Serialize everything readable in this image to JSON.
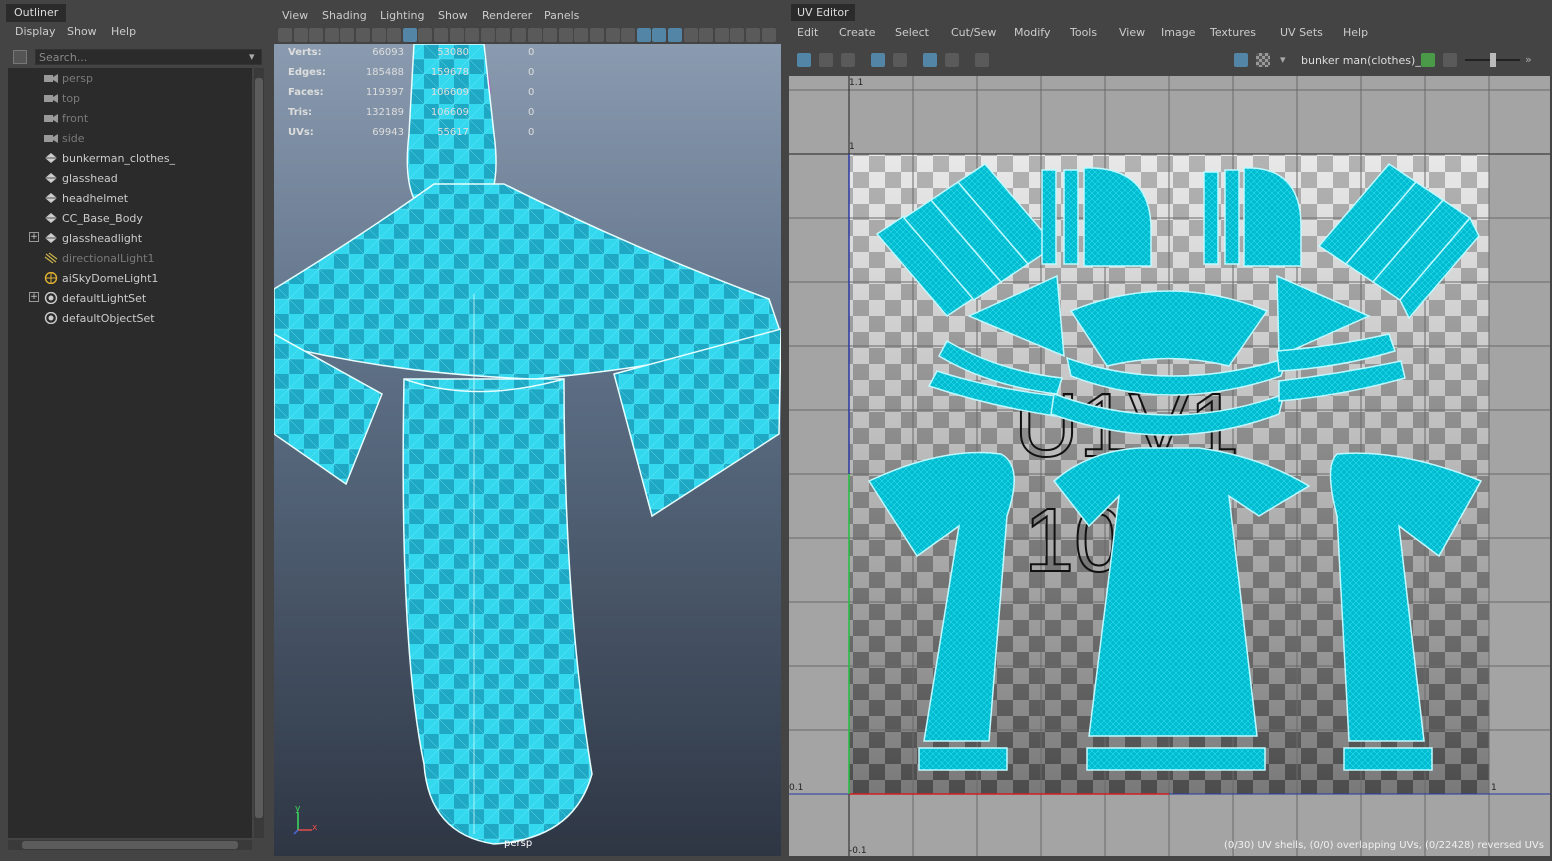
{
  "outliner": {
    "title": "Outliner",
    "menu": [
      "Display",
      "Show",
      "Help"
    ],
    "search_placeholder": "Search...",
    "items": [
      {
        "label": "persp",
        "icon": "camera-icon",
        "dim": true
      },
      {
        "label": "top",
        "icon": "camera-icon",
        "dim": true
      },
      {
        "label": "front",
        "icon": "camera-icon",
        "dim": true
      },
      {
        "label": "side",
        "icon": "camera-icon",
        "dim": true
      },
      {
        "label": "bunkerman_clothes_",
        "icon": "mesh-icon",
        "dim": false
      },
      {
        "label": "glasshead",
        "icon": "mesh-icon",
        "dim": false
      },
      {
        "label": "headhelmet",
        "icon": "mesh-icon",
        "dim": false
      },
      {
        "label": "CC_Base_Body",
        "icon": "mesh-icon",
        "dim": false
      },
      {
        "label": "glassheadlight",
        "icon": "mesh-icon",
        "dim": false,
        "expand": "+"
      },
      {
        "label": "directionalLight1",
        "icon": "directional-light-icon",
        "dim": true
      },
      {
        "label": "aiSkyDomeLight1",
        "icon": "skydome-icon",
        "dim": false
      },
      {
        "label": "defaultLightSet",
        "icon": "set-icon",
        "dim": false,
        "expand": "+"
      },
      {
        "label": "defaultObjectSet",
        "icon": "set-icon",
        "dim": false
      }
    ]
  },
  "viewport": {
    "menu": [
      "View",
      "Shading",
      "Lighting",
      "Show",
      "Renderer",
      "Panels"
    ],
    "camera_label": "persp",
    "hud": [
      {
        "key": "Verts:",
        "a": "66093",
        "b": "53080",
        "c": "0"
      },
      {
        "key": "Edges:",
        "a": "185488",
        "b": "159678",
        "c": "0"
      },
      {
        "key": "Faces:",
        "a": "119397",
        "b": "106609",
        "c": "0"
      },
      {
        "key": "Tris:",
        "a": "132189",
        "b": "106609",
        "c": "0"
      },
      {
        "key": "UVs:",
        "a": "69943",
        "b": "55617",
        "c": "0"
      }
    ],
    "axis_y": "y",
    "axis_x": "x"
  },
  "uv_editor": {
    "title": "UV Editor",
    "menu": [
      "Edit",
      "Create",
      "Select",
      "Cut/Sew",
      "Modify",
      "Tools",
      "View",
      "Image",
      "Textures",
      "UV Sets",
      "Help"
    ],
    "texture_name": "bunker man(clothes)_l",
    "coords": {
      "top": "1.1",
      "one": "1",
      "zero": "0.1",
      "bottom": "-0.1",
      "right_one": "1"
    },
    "tile_labels": [
      "U1V1",
      "1001"
    ],
    "status": "(0/30) UV shells, (0/0) overlapping UVs, (0/22428) reversed UVs",
    "colors": {
      "shell": "#00c4d8",
      "wire": "#2ee6f5",
      "grid_bg": "#a0a0a0"
    }
  }
}
